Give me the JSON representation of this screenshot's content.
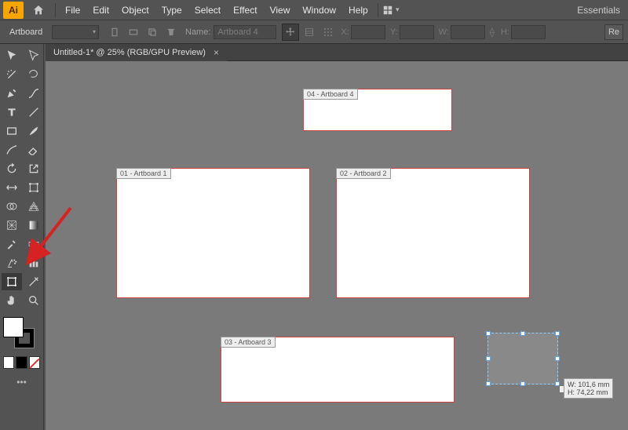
{
  "app": {
    "logo_letters": "Ai"
  },
  "menu": {
    "file": "File",
    "edit": "Edit",
    "object": "Object",
    "type": "Type",
    "select": "Select",
    "effect": "Effect",
    "view": "View",
    "window": "Window",
    "help": "Help"
  },
  "workspace": {
    "label": "Essentials"
  },
  "control": {
    "selector_label": "Artboard",
    "name_label": "Name:",
    "name_value": "Artboard 4",
    "x_label": "X:",
    "y_label": "Y:",
    "w_label": "W:",
    "h_label": "H:",
    "rebtn": "Re"
  },
  "tab": {
    "title": "Untitled-1* @ 25% (RGB/GPU Preview)",
    "close": "×"
  },
  "artboards": {
    "a1": {
      "tag": "01 - Artboard 1"
    },
    "a2": {
      "tag": "02 - Artboard 2"
    },
    "a3": {
      "tag": "03 - Artboard 3"
    },
    "a4": {
      "tag": "04 - Artboard 4"
    }
  },
  "drawhint": {
    "w_label": "W:",
    "w_value": "101,6 mm",
    "h_label": "H:",
    "h_value": "74,22 mm"
  }
}
